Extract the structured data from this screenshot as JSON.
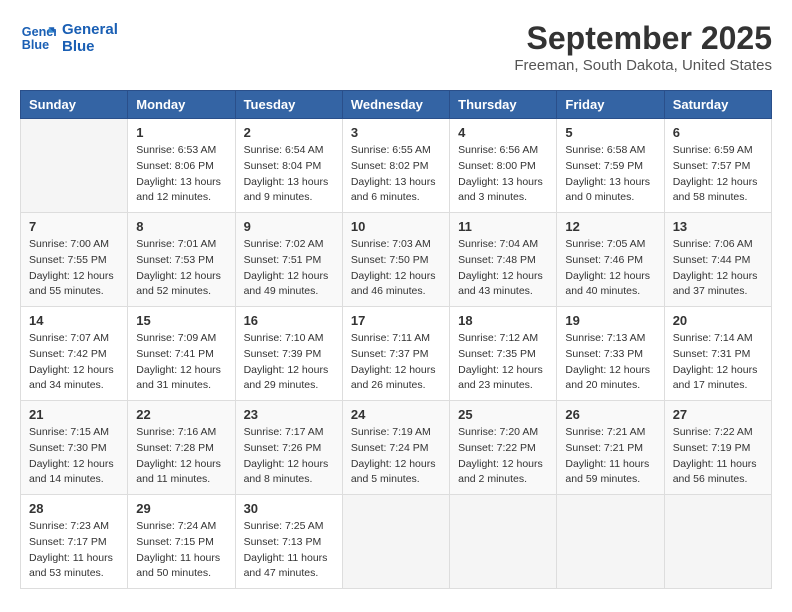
{
  "header": {
    "logo_line1": "General",
    "logo_line2": "Blue",
    "title": "September 2025",
    "subtitle": "Freeman, South Dakota, United States"
  },
  "calendar": {
    "days_of_week": [
      "Sunday",
      "Monday",
      "Tuesday",
      "Wednesday",
      "Thursday",
      "Friday",
      "Saturday"
    ],
    "weeks": [
      [
        {
          "day": "",
          "info": ""
        },
        {
          "day": "1",
          "info": "Sunrise: 6:53 AM\nSunset: 8:06 PM\nDaylight: 13 hours\nand 12 minutes."
        },
        {
          "day": "2",
          "info": "Sunrise: 6:54 AM\nSunset: 8:04 PM\nDaylight: 13 hours\nand 9 minutes."
        },
        {
          "day": "3",
          "info": "Sunrise: 6:55 AM\nSunset: 8:02 PM\nDaylight: 13 hours\nand 6 minutes."
        },
        {
          "day": "4",
          "info": "Sunrise: 6:56 AM\nSunset: 8:00 PM\nDaylight: 13 hours\nand 3 minutes."
        },
        {
          "day": "5",
          "info": "Sunrise: 6:58 AM\nSunset: 7:59 PM\nDaylight: 13 hours\nand 0 minutes."
        },
        {
          "day": "6",
          "info": "Sunrise: 6:59 AM\nSunset: 7:57 PM\nDaylight: 12 hours\nand 58 minutes."
        }
      ],
      [
        {
          "day": "7",
          "info": "Sunrise: 7:00 AM\nSunset: 7:55 PM\nDaylight: 12 hours\nand 55 minutes."
        },
        {
          "day": "8",
          "info": "Sunrise: 7:01 AM\nSunset: 7:53 PM\nDaylight: 12 hours\nand 52 minutes."
        },
        {
          "day": "9",
          "info": "Sunrise: 7:02 AM\nSunset: 7:51 PM\nDaylight: 12 hours\nand 49 minutes."
        },
        {
          "day": "10",
          "info": "Sunrise: 7:03 AM\nSunset: 7:50 PM\nDaylight: 12 hours\nand 46 minutes."
        },
        {
          "day": "11",
          "info": "Sunrise: 7:04 AM\nSunset: 7:48 PM\nDaylight: 12 hours\nand 43 minutes."
        },
        {
          "day": "12",
          "info": "Sunrise: 7:05 AM\nSunset: 7:46 PM\nDaylight: 12 hours\nand 40 minutes."
        },
        {
          "day": "13",
          "info": "Sunrise: 7:06 AM\nSunset: 7:44 PM\nDaylight: 12 hours\nand 37 minutes."
        }
      ],
      [
        {
          "day": "14",
          "info": "Sunrise: 7:07 AM\nSunset: 7:42 PM\nDaylight: 12 hours\nand 34 minutes."
        },
        {
          "day": "15",
          "info": "Sunrise: 7:09 AM\nSunset: 7:41 PM\nDaylight: 12 hours\nand 31 minutes."
        },
        {
          "day": "16",
          "info": "Sunrise: 7:10 AM\nSunset: 7:39 PM\nDaylight: 12 hours\nand 29 minutes."
        },
        {
          "day": "17",
          "info": "Sunrise: 7:11 AM\nSunset: 7:37 PM\nDaylight: 12 hours\nand 26 minutes."
        },
        {
          "day": "18",
          "info": "Sunrise: 7:12 AM\nSunset: 7:35 PM\nDaylight: 12 hours\nand 23 minutes."
        },
        {
          "day": "19",
          "info": "Sunrise: 7:13 AM\nSunset: 7:33 PM\nDaylight: 12 hours\nand 20 minutes."
        },
        {
          "day": "20",
          "info": "Sunrise: 7:14 AM\nSunset: 7:31 PM\nDaylight: 12 hours\nand 17 minutes."
        }
      ],
      [
        {
          "day": "21",
          "info": "Sunrise: 7:15 AM\nSunset: 7:30 PM\nDaylight: 12 hours\nand 14 minutes."
        },
        {
          "day": "22",
          "info": "Sunrise: 7:16 AM\nSunset: 7:28 PM\nDaylight: 12 hours\nand 11 minutes."
        },
        {
          "day": "23",
          "info": "Sunrise: 7:17 AM\nSunset: 7:26 PM\nDaylight: 12 hours\nand 8 minutes."
        },
        {
          "day": "24",
          "info": "Sunrise: 7:19 AM\nSunset: 7:24 PM\nDaylight: 12 hours\nand 5 minutes."
        },
        {
          "day": "25",
          "info": "Sunrise: 7:20 AM\nSunset: 7:22 PM\nDaylight: 12 hours\nand 2 minutes."
        },
        {
          "day": "26",
          "info": "Sunrise: 7:21 AM\nSunset: 7:21 PM\nDaylight: 11 hours\nand 59 minutes."
        },
        {
          "day": "27",
          "info": "Sunrise: 7:22 AM\nSunset: 7:19 PM\nDaylight: 11 hours\nand 56 minutes."
        }
      ],
      [
        {
          "day": "28",
          "info": "Sunrise: 7:23 AM\nSunset: 7:17 PM\nDaylight: 11 hours\nand 53 minutes."
        },
        {
          "day": "29",
          "info": "Sunrise: 7:24 AM\nSunset: 7:15 PM\nDaylight: 11 hours\nand 50 minutes."
        },
        {
          "day": "30",
          "info": "Sunrise: 7:25 AM\nSunset: 7:13 PM\nDaylight: 11 hours\nand 47 minutes."
        },
        {
          "day": "",
          "info": ""
        },
        {
          "day": "",
          "info": ""
        },
        {
          "day": "",
          "info": ""
        },
        {
          "day": "",
          "info": ""
        }
      ]
    ]
  }
}
